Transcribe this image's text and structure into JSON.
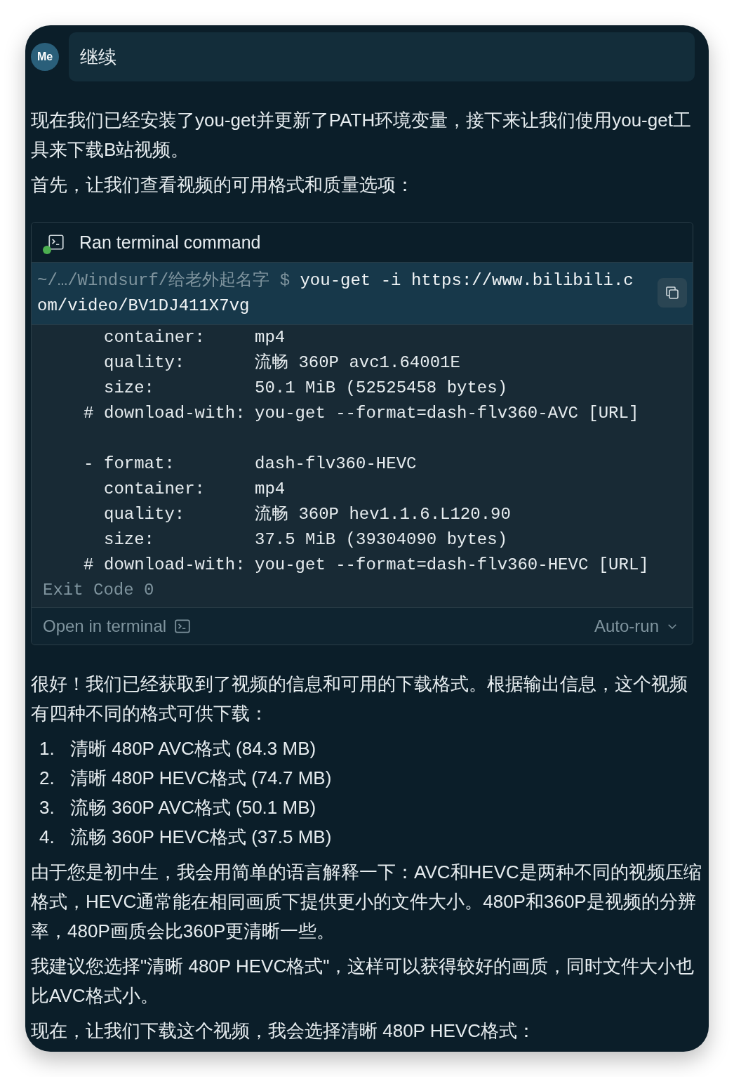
{
  "user_message": {
    "avatar": "Me",
    "text": "继续"
  },
  "intro": [
    "现在我们已经安装了you-get并更新了PATH环境变量，接下来让我们使用you-get工具来下载B站视频。",
    "首先，让我们查看视频的可用格式和质量选项："
  ],
  "terminal": {
    "title": "Ran terminal command",
    "status_dot": true,
    "path": "~/…/Windsurf/给老外起名字 $",
    "command": "you-get -i https://www.bilibili.com/video/BV1DJ411X7vg",
    "output_blocks": [
      {
        "rows": [
          {
            "key": "container:",
            "value": "mp4"
          },
          {
            "key": "quality:",
            "value": "流畅 360P avc1.64001E"
          },
          {
            "key": "size:",
            "value": "50.1 MiB (52525458 bytes)"
          },
          {
            "prefix": "#",
            "key": "download-with:",
            "value": "you-get --format=dash-flv360-AVC [URL]"
          }
        ]
      },
      {
        "rows": [
          {
            "prefix": "-",
            "key": "format:",
            "value": "dash-flv360-HEVC"
          },
          {
            "key": "container:",
            "value": "mp4"
          },
          {
            "key": "quality:",
            "value": "流畅 360P hev1.1.6.L120.90"
          },
          {
            "key": "size:",
            "value": "37.5 MiB (39304090 bytes)"
          },
          {
            "prefix": "#",
            "key": "download-with:",
            "value": "you-get --format=dash-flv360-HEVC [URL]"
          }
        ]
      }
    ],
    "exit_code": "Exit Code 0",
    "open_label": "Open in terminal",
    "run_mode": "Auto-run"
  },
  "reply": {
    "lead": "很好！我们已经获取到了视频的信息和可用的下载格式。根据输出信息，这个视频有四种不同的格式可供下载：",
    "list": [
      {
        "number": "1.",
        "text": "清晰 480P AVC格式 (84.3 MB)"
      },
      {
        "number": "2.",
        "text": "清晰 480P HEVC格式 (74.7 MB)"
      },
      {
        "number": "3.",
        "text": "流畅 360P AVC格式 (50.1 MB)"
      },
      {
        "number": "4.",
        "text": "流畅 360P HEVC格式 (37.5 MB)"
      }
    ],
    "paragraphs": [
      "由于您是初中生，我会用简单的语言解释一下：AVC和HEVC是两种不同的视频压缩格式，HEVC通常能在相同画质下提供更小的文件大小。480P和360P是视频的分辨率，480P画质会比360P更清晰一些。",
      "我建议您选择\"清晰 480P HEVC格式\"，这样可以获得较好的画质，同时文件大小也比AVC格式小。",
      "现在，让我们下载这个视频，我会选择清晰 480P HEVC格式："
    ]
  }
}
